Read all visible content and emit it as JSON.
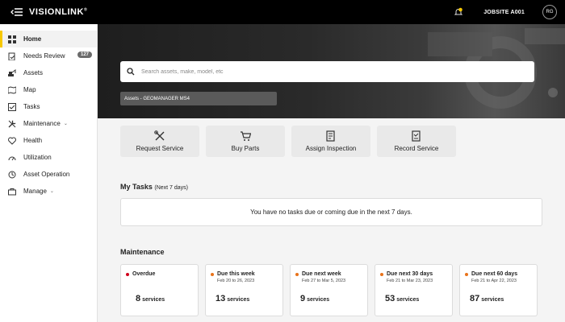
{
  "app": {
    "logo": "VISIONLINK",
    "logo_mark": "®"
  },
  "header": {
    "jobsite": "JOBSITE A001",
    "avatar_initials": "RG"
  },
  "sidebar": {
    "items": [
      {
        "label": "Home",
        "icon": "grid-icon",
        "active": true
      },
      {
        "label": "Needs Review",
        "icon": "clipboard-check-icon",
        "badge": "127"
      },
      {
        "label": "Assets",
        "icon": "excavator-icon"
      },
      {
        "label": "Map",
        "icon": "map-icon"
      },
      {
        "label": "Tasks",
        "icon": "tasks-icon"
      },
      {
        "label": "Maintenance",
        "icon": "wrench-icon",
        "chevron": "⌄"
      },
      {
        "label": "Health",
        "icon": "heart-pulse-icon"
      },
      {
        "label": "Utilization",
        "icon": "gauge-icon"
      },
      {
        "label": "Asset Operation",
        "icon": "asset-operation-icon"
      },
      {
        "label": "Manage",
        "icon": "briefcase-icon",
        "chevron": "⌄"
      }
    ]
  },
  "search": {
    "placeholder": "Search assets, make, model, etc"
  },
  "asset_chip": {
    "label": "Assets - GEOMANAGER MS4"
  },
  "actions": [
    {
      "label": "Request Service",
      "icon": "tools-icon"
    },
    {
      "label": "Buy Parts",
      "icon": "cart-icon"
    },
    {
      "label": "Assign Inspection",
      "icon": "assign-inspection-icon"
    },
    {
      "label": "Record Service",
      "icon": "record-service-icon"
    }
  ],
  "tasks": {
    "title": "My Tasks",
    "subtitle": "(Next 7 days)",
    "empty_message": "You have no tasks due or coming due in the next 7 days."
  },
  "maintenance": {
    "title": "Maintenance",
    "unit": "services",
    "cards": [
      {
        "label": "Overdue",
        "range": "",
        "count": "8",
        "color": "#d0021b"
      },
      {
        "label": "Due this week",
        "range": "Feb 20 to 26, 2023",
        "count": "13",
        "color": "#e8731a"
      },
      {
        "label": "Due next week",
        "range": "Feb 27 to Mar 5, 2023",
        "count": "9",
        "color": "#e8731a"
      },
      {
        "label": "Due next 30 days",
        "range": "Feb 21 to Mar 23, 2023",
        "count": "53",
        "color": "#e8731a"
      },
      {
        "label": "Due next 60 days",
        "range": "Feb 21 to Apr 22, 2023",
        "count": "87",
        "color": "#e8731a"
      }
    ]
  },
  "colors": {
    "accent": "#f7c800",
    "topbar": "#000000",
    "overdue": "#d0021b",
    "due": "#e8731a"
  }
}
